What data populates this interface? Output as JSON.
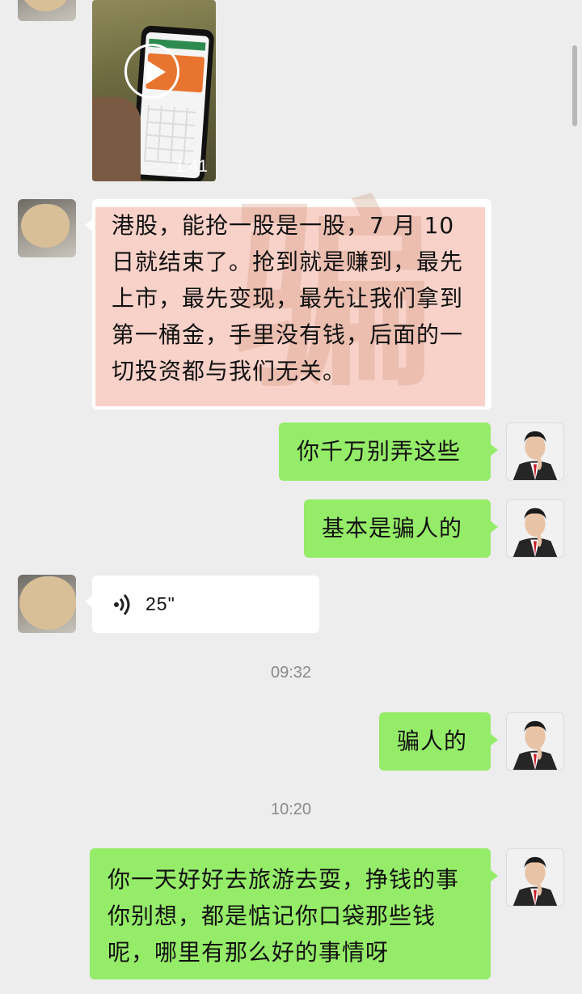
{
  "colors": {
    "background": "#ededed",
    "self_bubble": "#95ec69",
    "other_bubble": "#ffffff",
    "highlight": "#f8d2c9",
    "timestamp_text": "#8a8a8a"
  },
  "messages": {
    "video": {
      "duration": "1:41",
      "icon": "play-icon"
    },
    "stock_post": {
      "text": "港股，能抢一股是一股，7 月 10 日就结束了。抢到就是赚到，最先上市，最先变现，最先让我们拿到第一桶金，手里没有钱，后面的一切投资都与我们无关。"
    },
    "reply1": {
      "text": "你千万别弄这些"
    },
    "reply2": {
      "text": "基本是骗人的"
    },
    "voice": {
      "duration": "25\"",
      "icon": "voice-wave-icon"
    },
    "time1": "09:32",
    "reply3": {
      "text": "骗人的"
    },
    "time2": "10:20",
    "reply4": {
      "text": "你一天好好去旅游去耍，挣钱的事你别想，都是惦记你口袋那些钱呢，哪里有那么好的事情呀"
    }
  }
}
